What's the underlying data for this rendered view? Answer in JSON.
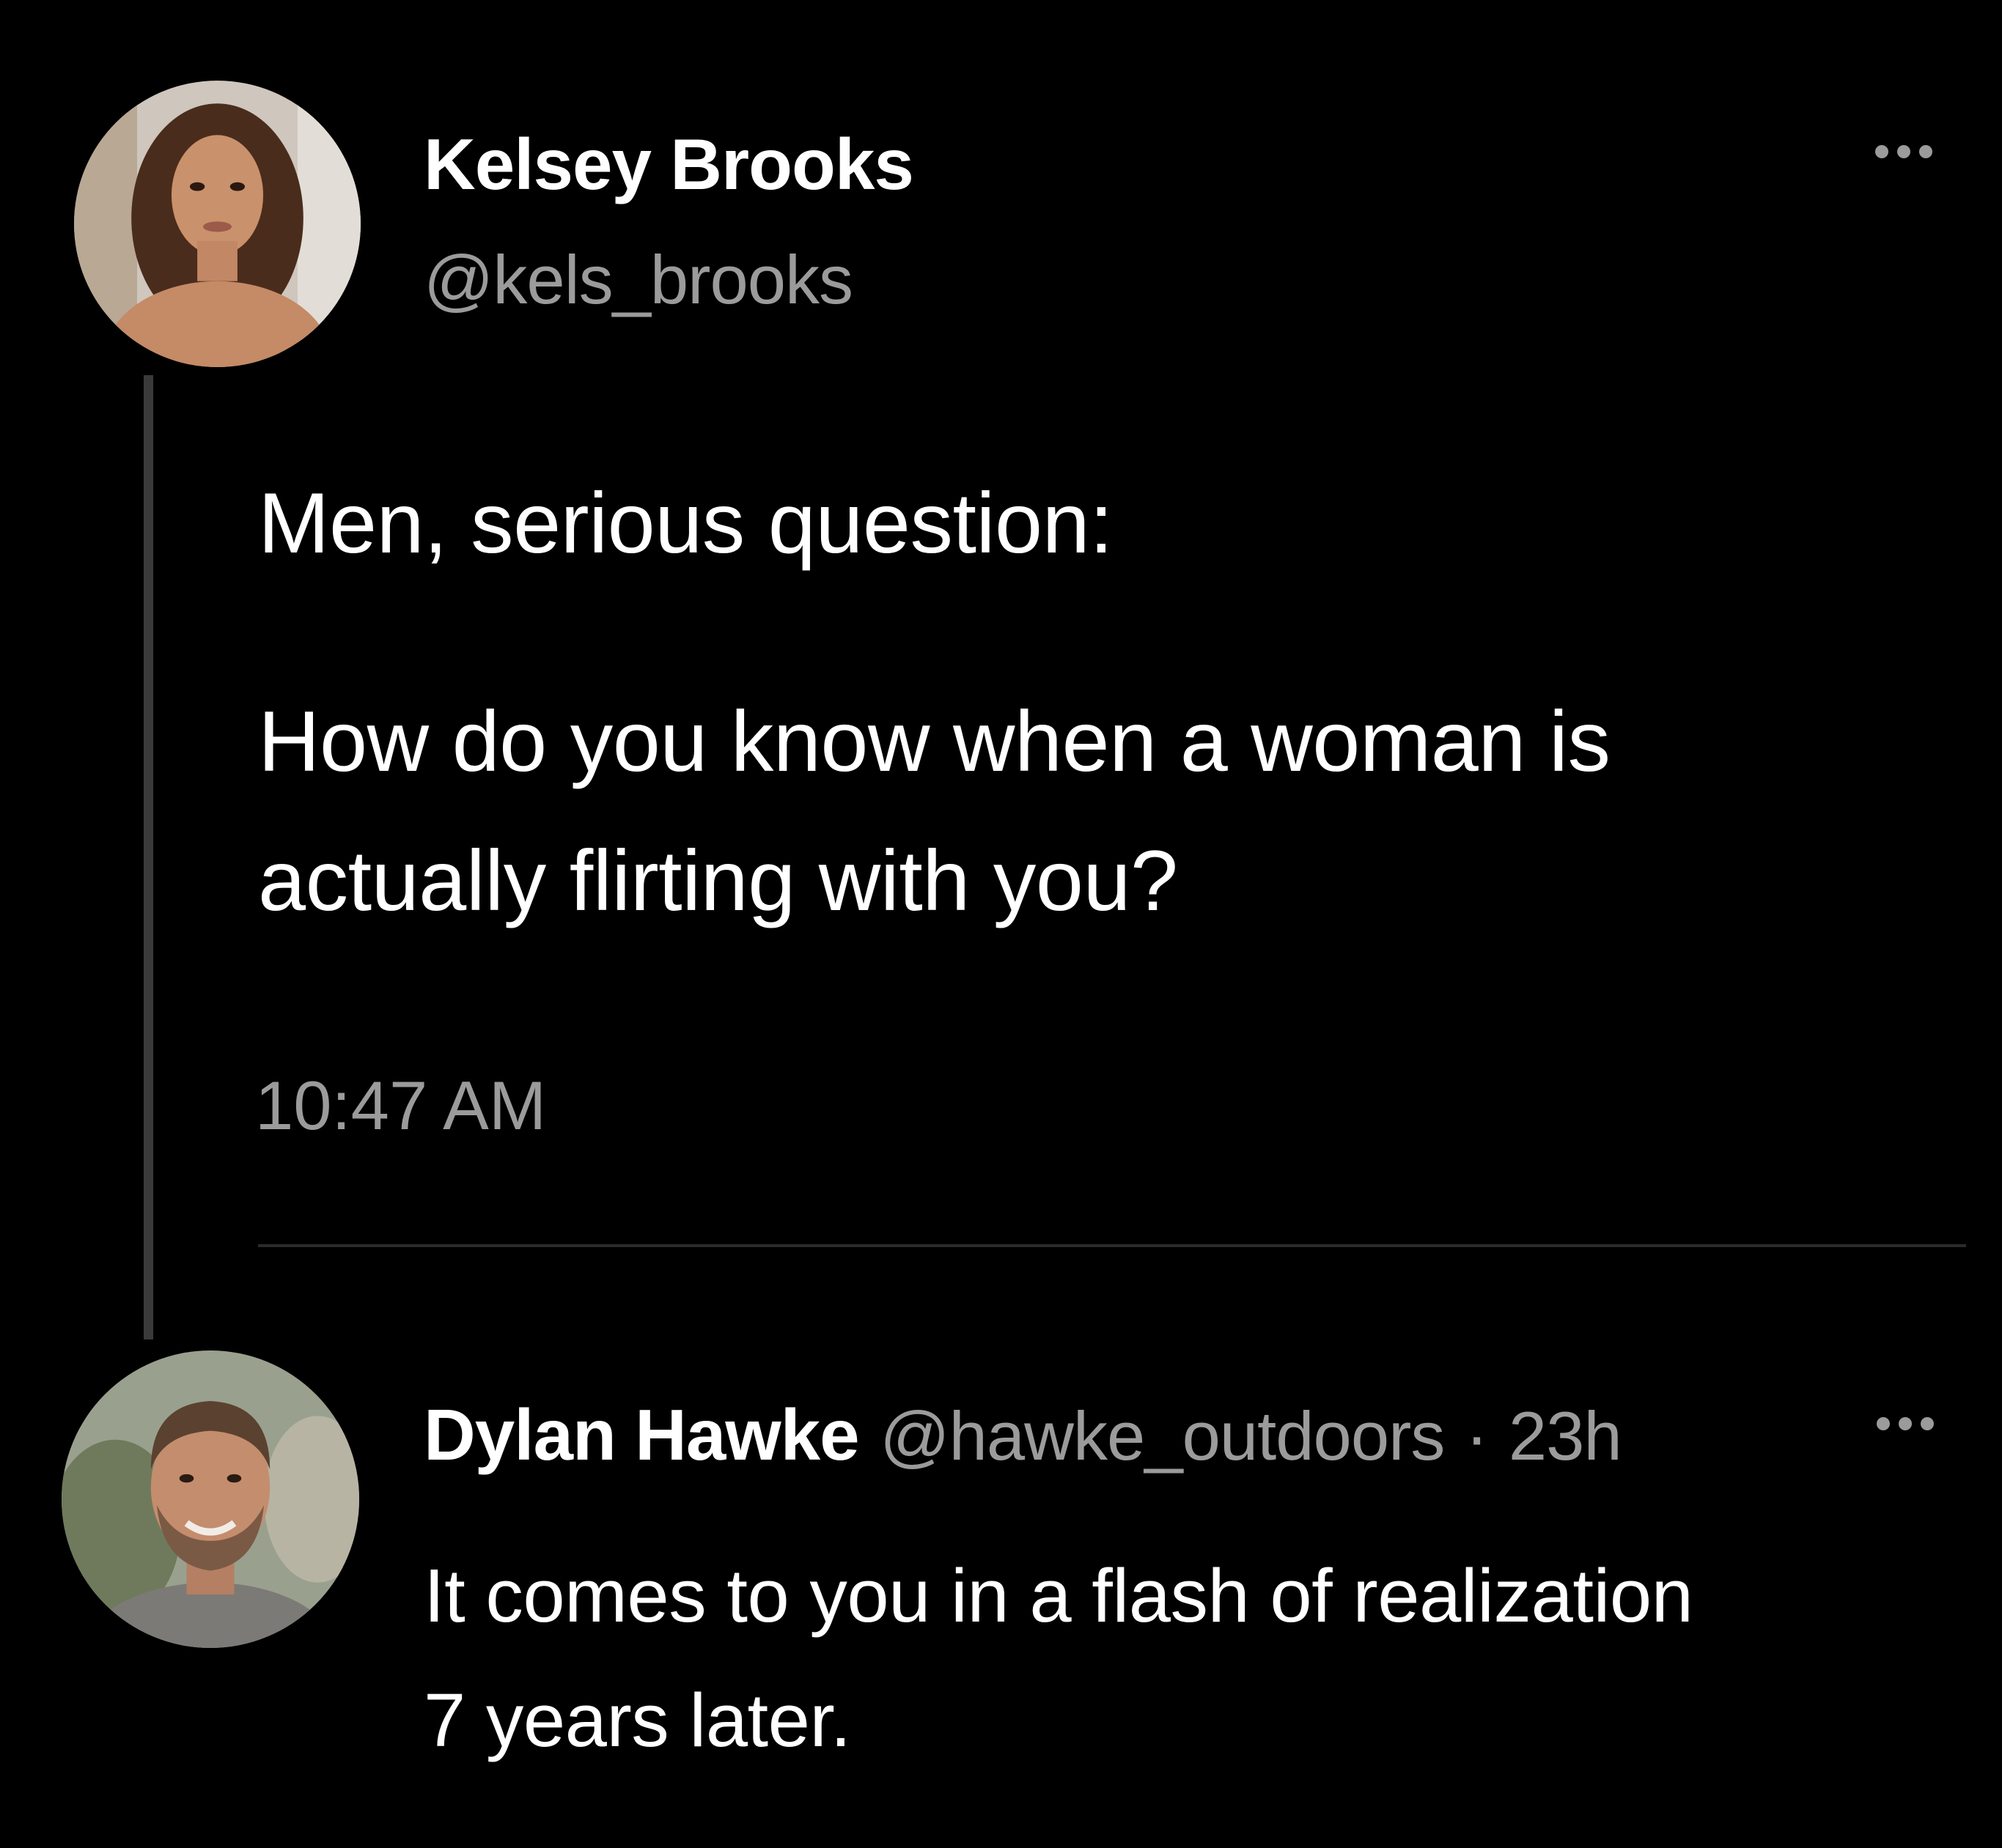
{
  "tweet": {
    "author": {
      "name": "Kelsey Brooks",
      "handle": "@kels_brooks",
      "avatar_icon": "avatar-woman-photo"
    },
    "lines": [
      "Men, serious question:",
      "How do you know when a woman is",
      "actually flirting with you?"
    ],
    "timestamp": "10:47 AM",
    "more_icon": "ellipsis-icon"
  },
  "reply": {
    "author": {
      "name": "Dylan Hawke",
      "handle": "@hawke_outdoors",
      "avatar_icon": "avatar-man-photo"
    },
    "separator": "·",
    "age": "23h",
    "lines": [
      "It comes to you in a flash of realization",
      "7 years later."
    ],
    "more_icon": "ellipsis-icon"
  },
  "colors": {
    "background": "#000000",
    "primary_text": "#ffffff",
    "secondary_text": "#9b9b9b",
    "divider": "#2b2b2b",
    "thread_line": "#3a3a3a"
  }
}
